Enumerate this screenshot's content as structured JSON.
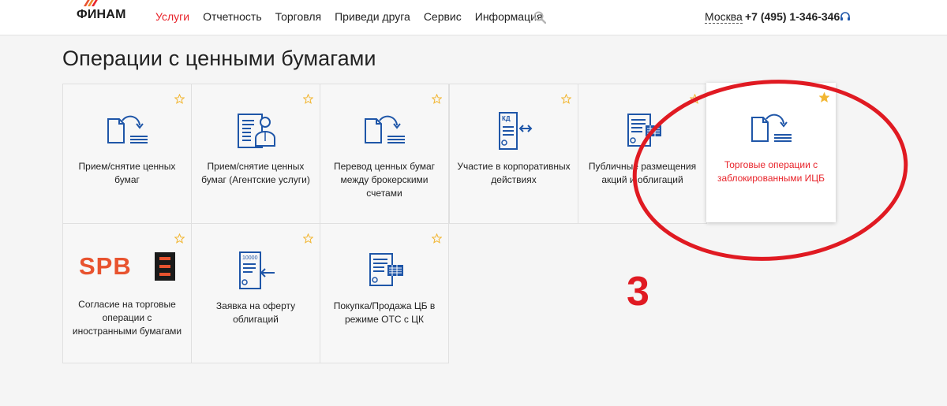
{
  "header": {
    "logo_text": "ФИНАМ",
    "nav": [
      "Услуги",
      "Отчетность",
      "Торговля",
      "Приведи друга",
      "Сервис",
      "Информация"
    ],
    "city": "Москва",
    "phone": "+7 (495) 1-346-346"
  },
  "page": {
    "title": "Операции с ценными бумагами"
  },
  "tiles": [
    {
      "label": "Прием/снятие ценных бумаг",
      "icon": "doc-arrow-icon",
      "starred": false
    },
    {
      "label": "Прием/снятие ценных бумаг (Агентские услуги)",
      "icon": "agent-doc-icon",
      "starred": false
    },
    {
      "label": "Перевод ценных бумаг между брокерскими счетами",
      "icon": "doc-arrow-icon",
      "starred": false
    },
    {
      "label": "Участие в корпоративных действиях",
      "icon": "kd-doc-icon",
      "starred": false,
      "icon_text": "КД"
    },
    {
      "label": "Публичные размещения акций и облигаций",
      "icon": "stack-doc-icon",
      "starred": false
    },
    {
      "label": "Торговые операции с заблокированными ИЦБ",
      "icon": "doc-arrow-icon",
      "starred": true
    },
    {
      "label": "Согласие на торговые операции с иностранными бумагами",
      "icon": "spb-logo",
      "starred": false,
      "logo_text": "SPB"
    },
    {
      "label": "Заявка на оферту облигаций",
      "icon": "offer-doc-icon",
      "starred": false,
      "icon_text": "10000"
    },
    {
      "label": "Покупка/Продажа ЦБ в режиме ОТС с ЦК",
      "icon": "stack-doc-icon",
      "starred": false
    }
  ],
  "annotation": {
    "number": "3"
  },
  "colors": {
    "accent_red": "#e8232a",
    "icon_blue": "#1f56a8",
    "star_gold": "#f2b632"
  }
}
